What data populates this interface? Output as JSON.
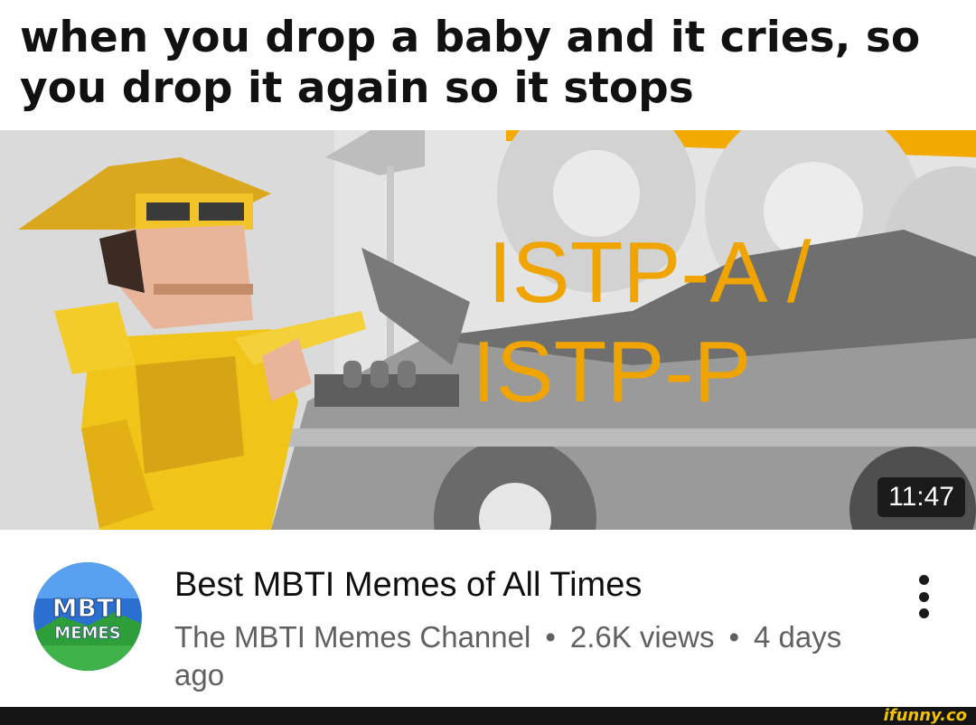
{
  "meme": {
    "caption": "when you drop a baby and it cries, so you drop it again so it stops"
  },
  "thumbnail": {
    "overlay_line1": "ISTP-A /",
    "overlay_line2": "ISTP-P",
    "duration": "11:47",
    "accent_color": "#f0a400"
  },
  "video": {
    "title": "Best MBTI Memes of All Times",
    "channel": "The MBTI Memes Channel",
    "views": "2.6K views",
    "age": "4 days ago",
    "separator": "•",
    "menu_icon": "more-vert-icon"
  },
  "channel_avatar": {
    "line1": "MBTI",
    "line2": "MEMES"
  },
  "watermark": {
    "text": "ifunny.co"
  }
}
